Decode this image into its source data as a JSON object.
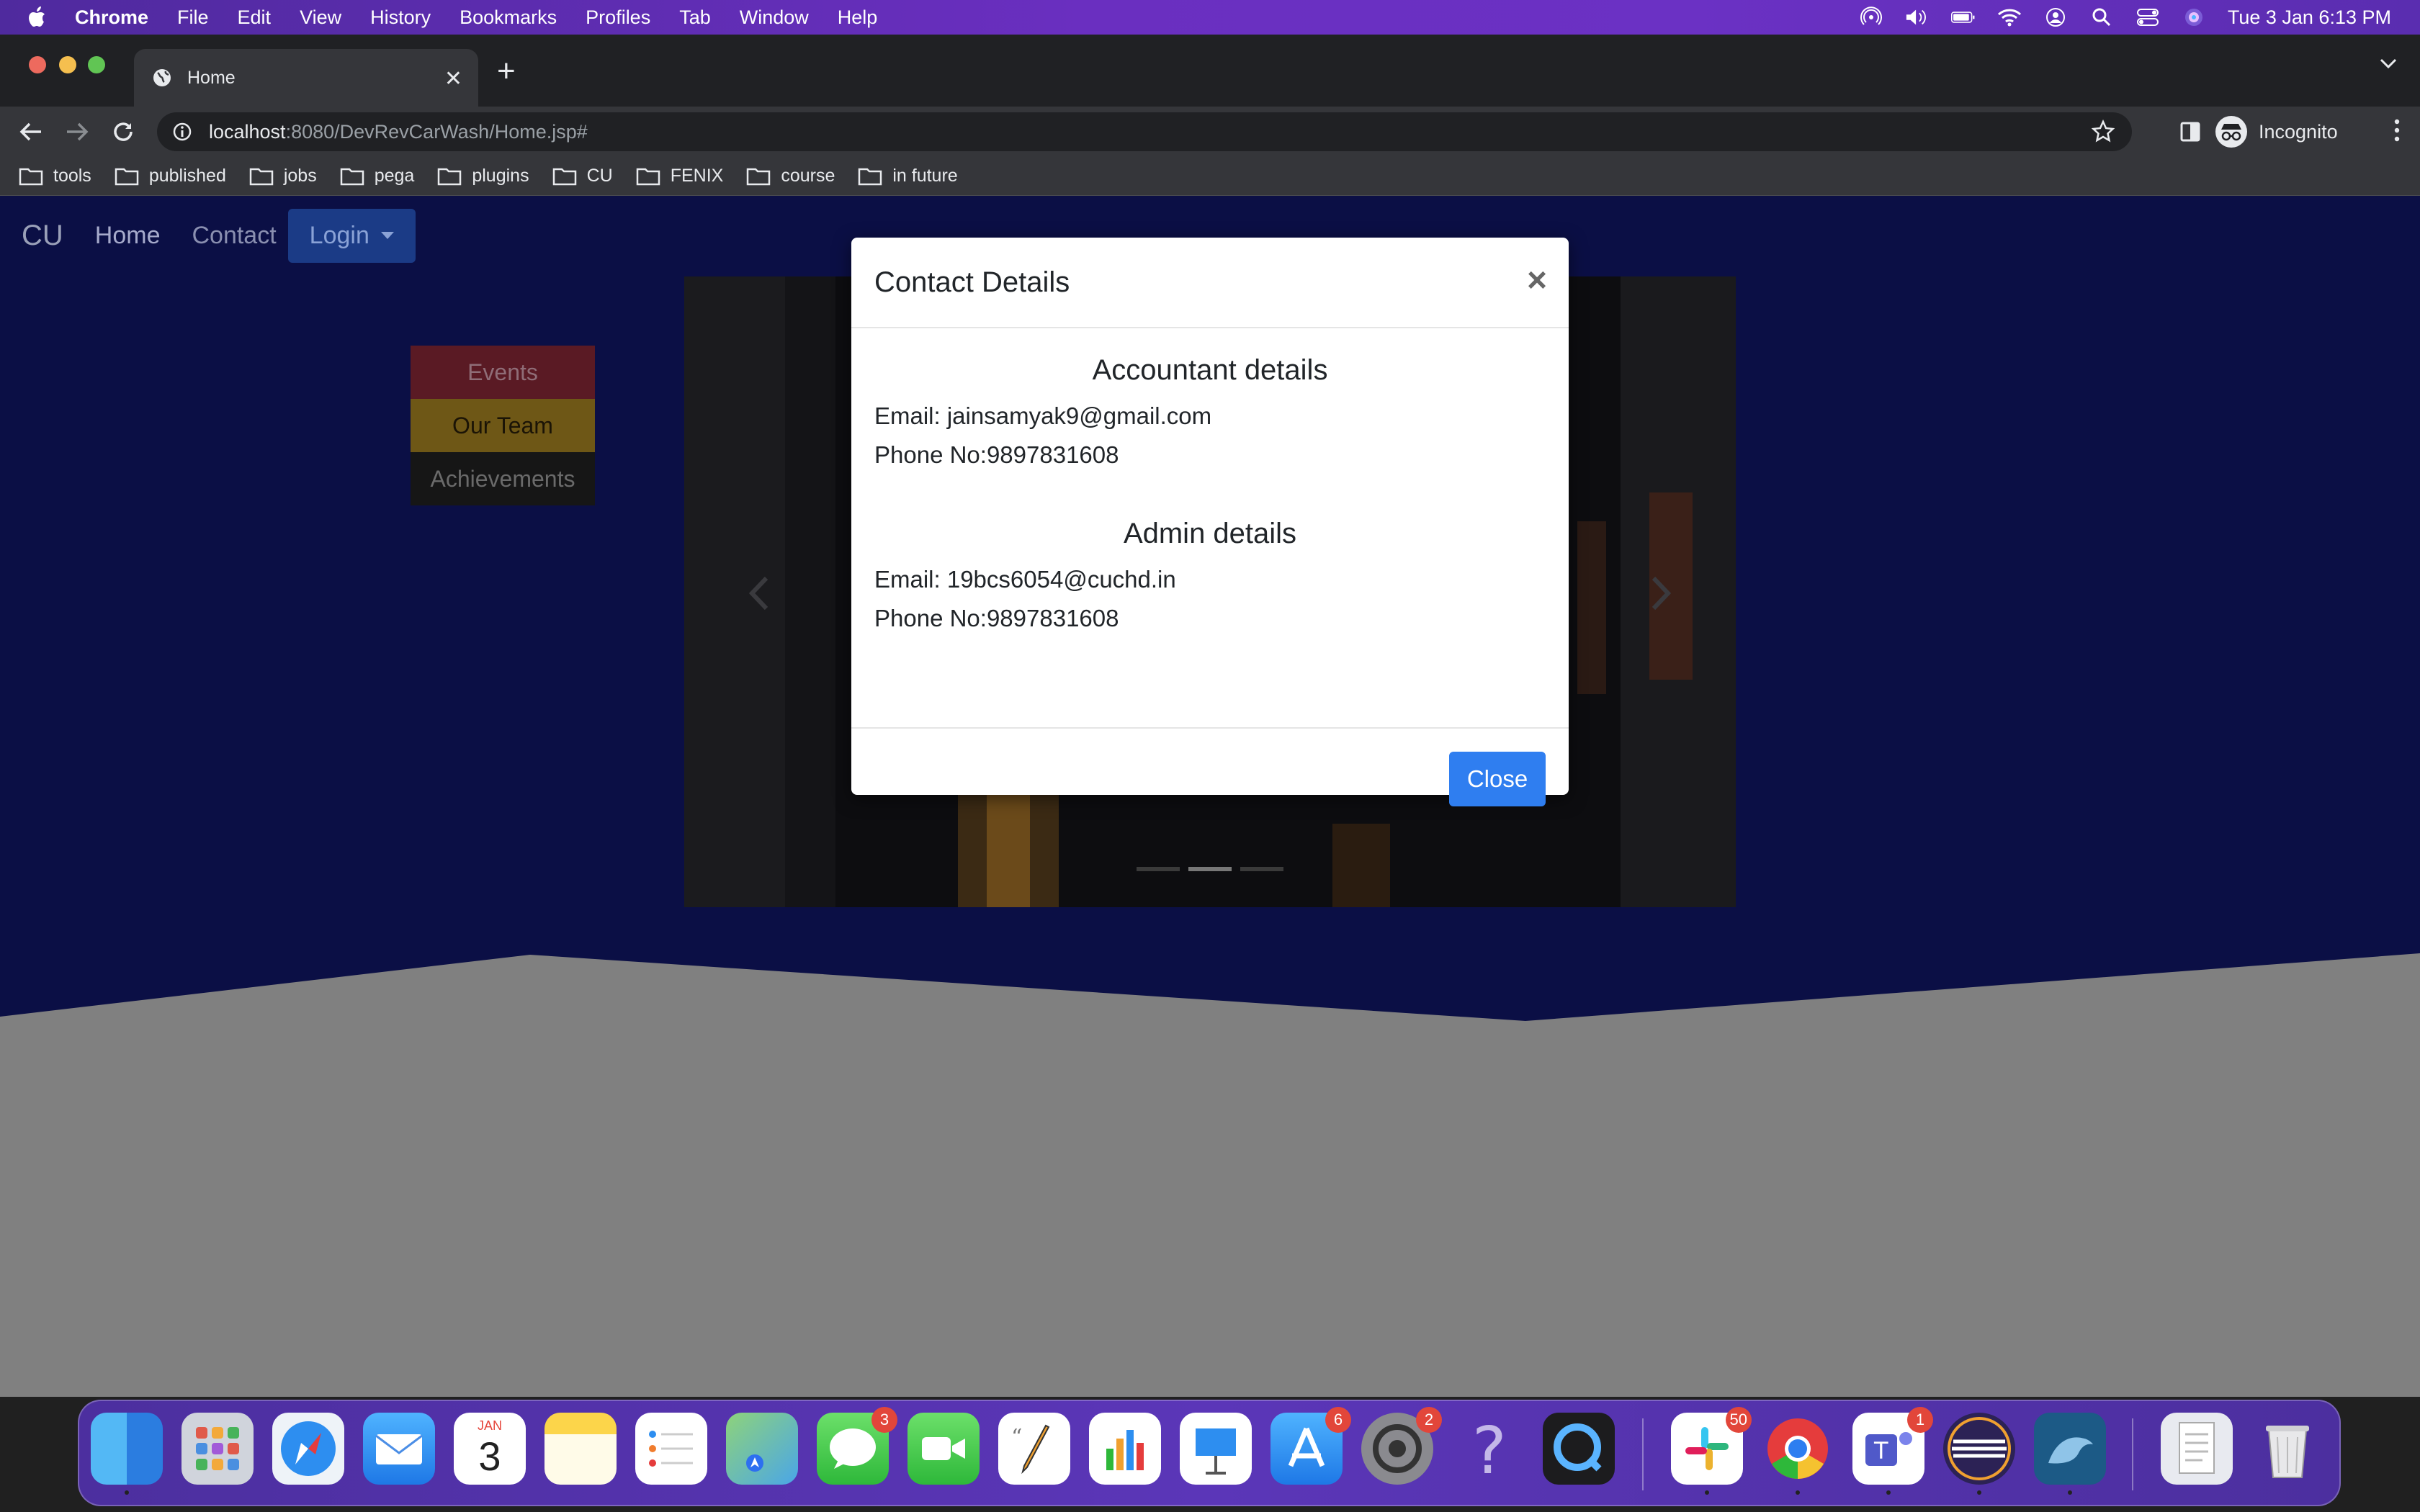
{
  "menubar": {
    "app": "Chrome",
    "items": [
      "File",
      "Edit",
      "View",
      "History",
      "Bookmarks",
      "Profiles",
      "Tab",
      "Window",
      "Help"
    ],
    "datetime": "Tue 3 Jan  6:13 PM"
  },
  "browser": {
    "tab_title": "Home",
    "url_host": "localhost",
    "url_rest": ":8080/DevRevCarWash/Home.jsp#",
    "profile_label": "Incognito",
    "bookmarks": [
      "tools",
      "published",
      "jobs",
      "pega",
      "plugins",
      "CU",
      "FENIX",
      "course",
      "in future"
    ]
  },
  "site": {
    "brand": "CU",
    "nav": {
      "home": "Home",
      "contact": "Contact",
      "login": "Login"
    },
    "sidemenu": [
      "Events",
      "Our Team",
      "Achievements"
    ]
  },
  "modal": {
    "title": "Contact Details",
    "close_symbol": "×",
    "accountant": {
      "heading": "Accountant details",
      "email": "Email: jainsamyak9@gmail.com",
      "phone": "Phone No:9897831608"
    },
    "admin": {
      "heading": "Admin details",
      "email": "Email: 19bcs6054@cuchd.in",
      "phone": "Phone No:9897831608"
    },
    "close_button": "Close"
  },
  "dock": {
    "badges": {
      "messages": "3",
      "appstore": "6",
      "settings": "2",
      "slack": "50",
      "teams": "1"
    },
    "calendar": {
      "month": "JAN",
      "day": "3"
    }
  },
  "colors": {
    "navy_bg": "#0b0f45",
    "gray_bg": "#808080",
    "primary_button": "#2f7ef0"
  }
}
